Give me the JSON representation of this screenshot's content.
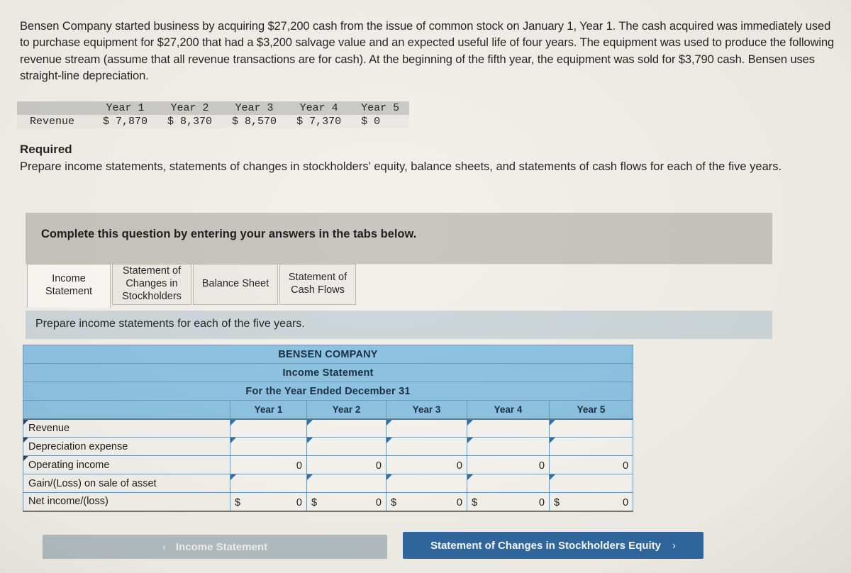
{
  "problem": {
    "text": "Bensen Company started business by acquiring $27,200 cash from the issue of common stock on January 1, Year 1. The cash acquired was immediately used to purchase equipment for $27,200 that had a $3,200 salvage value and an expected useful life of four years. The equipment was used to produce the following revenue stream (assume that all revenue transactions are for cash). At the beginning of the fifth year, the equipment was sold for $3,790 cash. Bensen uses straight-line depreciation."
  },
  "revenue_table": {
    "header_blank": "",
    "years": [
      "Year 1",
      "Year 2",
      "Year 3",
      "Year 4",
      "Year 5"
    ],
    "row_label": "Revenue",
    "values": [
      "$ 7,870",
      "$ 8,370",
      "$ 8,570",
      "$ 7,370",
      "$ 0"
    ]
  },
  "required": {
    "title": "Required",
    "text": "Prepare income statements, statements of changes in stockholders' equity, balance sheets, and statements of cash flows for each of the five years."
  },
  "banner": {
    "text": "Complete this question by entering your answers in the tabs below."
  },
  "tabs": [
    {
      "label": "Income Statement",
      "active": true
    },
    {
      "label": "Statement of Changes in Stockholders",
      "active": false
    },
    {
      "label": "Balance Sheet",
      "active": false
    },
    {
      "label": "Statement of Cash Flows",
      "active": false
    }
  ],
  "instruction": {
    "text": "Prepare income statements for each of the five years."
  },
  "income_statement": {
    "company": "BENSEN COMPANY",
    "statement_title": "Income Statement",
    "period": "For the Year Ended December 31",
    "blank_corner": "",
    "column_headers": [
      "Year 1",
      "Year 2",
      "Year 3",
      "Year 4",
      "Year 5"
    ],
    "rows": [
      {
        "label": "Revenue",
        "has_label_marker": true,
        "type": "input",
        "cells": [
          {
            "dollar": "",
            "value": "",
            "marker": true
          },
          {
            "dollar": "",
            "value": "",
            "marker": true
          },
          {
            "dollar": "",
            "value": "",
            "marker": true
          },
          {
            "dollar": "",
            "value": "",
            "marker": true
          },
          {
            "dollar": "",
            "value": "",
            "marker": true
          }
        ]
      },
      {
        "label": "Depreciation expense",
        "has_label_marker": true,
        "type": "input",
        "cells": [
          {
            "dollar": "",
            "value": "",
            "marker": true
          },
          {
            "dollar": "",
            "value": "",
            "marker": true
          },
          {
            "dollar": "",
            "value": "",
            "marker": true
          },
          {
            "dollar": "",
            "value": "",
            "marker": true
          },
          {
            "dollar": "",
            "value": "",
            "marker": true
          }
        ]
      },
      {
        "label": "Operating income",
        "has_label_marker": true,
        "type": "computed",
        "cells": [
          {
            "dollar": "",
            "value": "0",
            "marker": false
          },
          {
            "dollar": "",
            "value": "0",
            "marker": false
          },
          {
            "dollar": "",
            "value": "0",
            "marker": false
          },
          {
            "dollar": "",
            "value": "0",
            "marker": false
          },
          {
            "dollar": "",
            "value": "0",
            "marker": false
          }
        ]
      },
      {
        "label": "Gain/(Loss) on sale of asset",
        "has_label_marker": false,
        "type": "input",
        "cells": [
          {
            "dollar": "",
            "value": "",
            "marker": true
          },
          {
            "dollar": "",
            "value": "",
            "marker": true
          },
          {
            "dollar": "",
            "value": "",
            "marker": true
          },
          {
            "dollar": "",
            "value": "",
            "marker": true
          },
          {
            "dollar": "",
            "value": "",
            "marker": true
          }
        ]
      },
      {
        "label": "Net income/(loss)",
        "has_label_marker": false,
        "type": "total",
        "cells": [
          {
            "dollar": "$",
            "value": "0",
            "marker": false
          },
          {
            "dollar": "$",
            "value": "0",
            "marker": false
          },
          {
            "dollar": "$",
            "value": "0",
            "marker": false
          },
          {
            "dollar": "$",
            "value": "0",
            "marker": false
          },
          {
            "dollar": "$",
            "value": "0",
            "marker": false
          }
        ]
      }
    ]
  },
  "navigation": {
    "prev_chevron": "‹",
    "prev_label": "Income Statement",
    "next_label": "Statement of Changes in Stockholders Equity",
    "next_chevron": "›"
  },
  "colors": {
    "table_header_blue": "#89c1e2",
    "table_border_blue": "#6b97b8",
    "banner_gray": "#c6c3bd",
    "instruction_blue_gray": "#ccd6da",
    "next_button_blue": "#29649f",
    "prev_button_gray": "#b2bcc0",
    "page_background": "#f2f0ea"
  }
}
